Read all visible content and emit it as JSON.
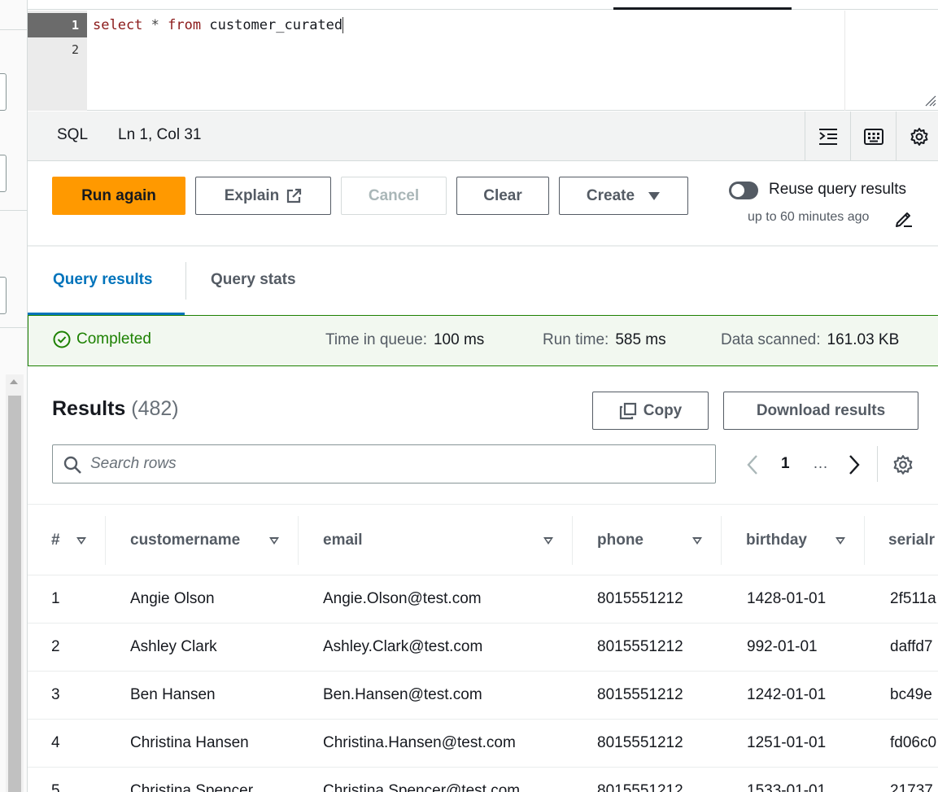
{
  "editor": {
    "lines": [
      "1",
      "2"
    ],
    "code": {
      "kw_select": "select",
      "op_star": "*",
      "kw_from": "from",
      "table": "customer_curated"
    }
  },
  "statusbar": {
    "language": "SQL",
    "position": "Ln 1, Col 31",
    "icons": [
      "format-icon",
      "keyboard-icon",
      "settings-icon"
    ]
  },
  "actions": {
    "run": "Run again",
    "explain": "Explain",
    "cancel": "Cancel",
    "clear": "Clear",
    "create": "Create",
    "reuse_label": "Reuse query results",
    "reuse_sub": "up to 60 minutes ago",
    "reuse_enabled": false
  },
  "tabs": [
    {
      "label": "Query results",
      "active": true
    },
    {
      "label": "Query stats",
      "active": false
    }
  ],
  "status": {
    "state": "Completed",
    "queue_label": "Time in queue:",
    "queue_value": "100 ms",
    "run_label": "Run time:",
    "run_value": "585 ms",
    "scanned_label": "Data scanned:",
    "scanned_value": "161.03 KB"
  },
  "results": {
    "title": "Results",
    "count": "(482)",
    "copy": "Copy",
    "download": "Download results",
    "search_placeholder": "Search rows",
    "page": "1",
    "ellipsis": "…"
  },
  "table": {
    "columns": [
      "#",
      "customername",
      "email",
      "phone",
      "birthday",
      "serialr"
    ],
    "rows": [
      [
        "1",
        "Angie Olson",
        "Angie.Olson@test.com",
        "8015551212",
        "1428-01-01",
        "2f511a"
      ],
      [
        "2",
        "Ashley Clark",
        "Ashley.Clark@test.com",
        "8015551212",
        "992-01-01",
        "daffd7"
      ],
      [
        "3",
        "Ben Hansen",
        "Ben.Hansen@test.com",
        "8015551212",
        "1242-01-01",
        "bc49e"
      ],
      [
        "4",
        "Christina Hansen",
        "Christina.Hansen@test.com",
        "8015551212",
        "1251-01-01",
        "fd06c0"
      ],
      [
        "5",
        "Christina Spencer",
        "Christina.Spencer@test.com",
        "8015551212",
        "1533-01-01",
        "21737"
      ]
    ]
  },
  "colors": {
    "primary": "#ff9900",
    "link": "#0073bb",
    "success": "#1d8102"
  }
}
